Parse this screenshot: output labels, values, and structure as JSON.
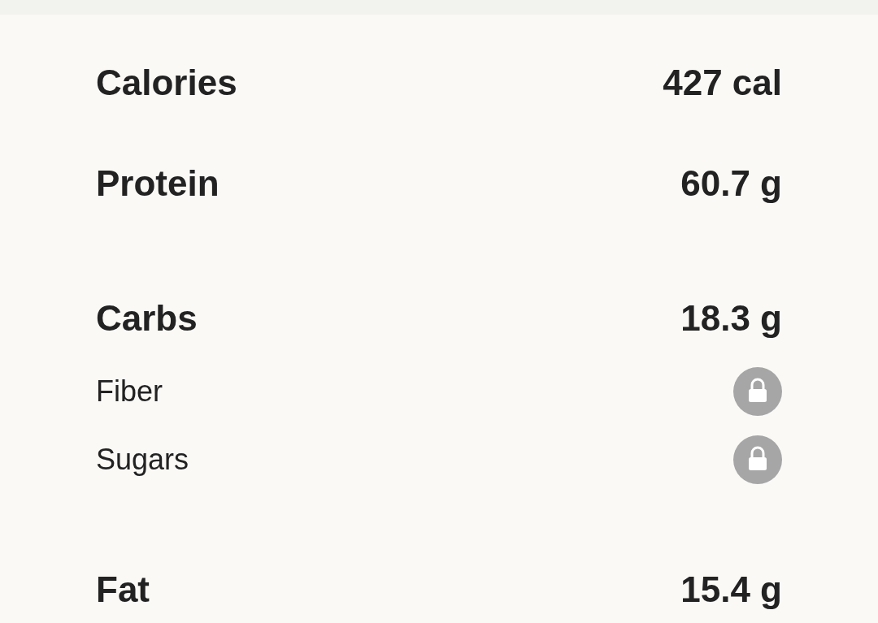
{
  "sections": [
    {
      "items": [
        {
          "kind": "major",
          "label": "Calories",
          "value": "427 cal"
        },
        {
          "kind": "major",
          "label": "Protein",
          "value": "60.7 g"
        }
      ]
    },
    {
      "items": [
        {
          "kind": "major",
          "label": "Carbs",
          "value": "18.3 g"
        },
        {
          "kind": "minor",
          "label": "Fiber",
          "locked": true
        },
        {
          "kind": "minor",
          "label": "Sugars",
          "locked": true
        }
      ]
    },
    {
      "items": [
        {
          "kind": "major",
          "label": "Fat",
          "value": "15.4 g"
        }
      ]
    }
  ]
}
